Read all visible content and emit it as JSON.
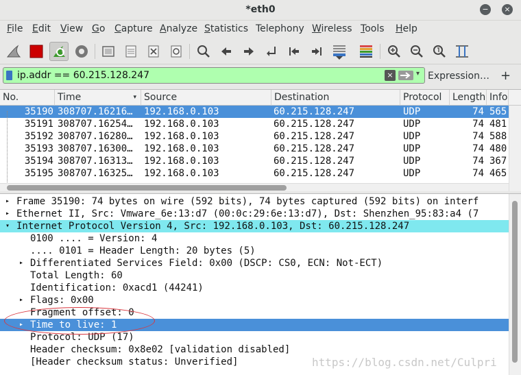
{
  "window": {
    "title": "*eth0",
    "minimize_glyph": "−",
    "close_glyph": "×"
  },
  "menubar": {
    "items": [
      {
        "acc": "F",
        "rest": "ile"
      },
      {
        "acc": "E",
        "rest": "dit"
      },
      {
        "acc": "V",
        "rest": "iew"
      },
      {
        "acc": "G",
        "rest": "o"
      },
      {
        "acc": "C",
        "rest": "apture"
      },
      {
        "acc": "A",
        "rest": "nalyze"
      },
      {
        "acc": "S",
        "rest": "tatistics"
      },
      {
        "acc": "",
        "rest": "Telephony"
      },
      {
        "acc": "W",
        "rest": "ireless"
      },
      {
        "acc": "T",
        "rest": "ools"
      },
      {
        "acc": "H",
        "rest": "elp"
      }
    ]
  },
  "toolbar": {
    "icons": [
      "shark-fin-icon",
      "stop-capture-icon",
      "restart-capture-icon",
      "capture-options-icon",
      "open-file-icon",
      "save-file-icon",
      "close-file-icon",
      "reload-file-icon",
      "find-packet-icon",
      "go-back-icon",
      "go-forward-icon",
      "go-to-packet-icon",
      "first-packet-icon",
      "last-packet-icon",
      "auto-scroll-icon",
      "colorize-icon",
      "zoom-in-icon",
      "zoom-out-icon",
      "normal-size-icon",
      "resize-columns-icon"
    ],
    "accent_red": "#cc0000",
    "accent_green": "#3c9a2c"
  },
  "filter": {
    "value": "ip.addr == 60.215.128.247",
    "expression_label": "Expression…",
    "add_label": "+",
    "bg_color": "#afffaf"
  },
  "packet_list": {
    "columns": [
      "No.",
      "Time",
      "Source",
      "Destination",
      "Protocol",
      "Length",
      "Info"
    ],
    "rows": [
      {
        "no": "35190",
        "time": "308707.16216…",
        "src": "192.168.0.103",
        "dst": "60.215.128.247",
        "proto": "UDP",
        "len": "74",
        "info": "565"
      },
      {
        "no": "35191",
        "time": "308707.16254…",
        "src": "192.168.0.103",
        "dst": "60.215.128.247",
        "proto": "UDP",
        "len": "74",
        "info": "481"
      },
      {
        "no": "35192",
        "time": "308707.16280…",
        "src": "192.168.0.103",
        "dst": "60.215.128.247",
        "proto": "UDP",
        "len": "74",
        "info": "588"
      },
      {
        "no": "35193",
        "time": "308707.16300…",
        "src": "192.168.0.103",
        "dst": "60.215.128.247",
        "proto": "UDP",
        "len": "74",
        "info": "480"
      },
      {
        "no": "35194",
        "time": "308707.16313…",
        "src": "192.168.0.103",
        "dst": "60.215.128.247",
        "proto": "UDP",
        "len": "74",
        "info": "367"
      },
      {
        "no": "35195",
        "time": "308707.16325…",
        "src": "192.168.0.103",
        "dst": "60.215.128.247",
        "proto": "UDP",
        "len": "74",
        "info": "465"
      }
    ],
    "selected_index": 0,
    "selected_color": "#4a90d9"
  },
  "packet_details": {
    "rows": [
      {
        "text": "Frame 35190: 74 bytes on wire (592 bits), 74 bytes captured (592 bits) on interf",
        "arrow": "▸",
        "indent": 0,
        "hl": ""
      },
      {
        "text": "Ethernet II, Src: Vmware_6e:13:d7 (00:0c:29:6e:13:d7), Dst: Shenzhen_95:83:a4 (7",
        "arrow": "▸",
        "indent": 0,
        "hl": ""
      },
      {
        "text": "Internet Protocol Version 4, Src: 192.168.0.103, Dst: 60.215.128.247",
        "arrow": "▾",
        "indent": 0,
        "hl": "cyan"
      },
      {
        "text": "0100 .... = Version: 4",
        "arrow": "",
        "indent": 1,
        "hl": ""
      },
      {
        "text": ".... 0101 = Header Length: 20 bytes (5)",
        "arrow": "",
        "indent": 1,
        "hl": ""
      },
      {
        "text": "Differentiated Services Field: 0x00 (DSCP: CS0, ECN: Not-ECT)",
        "arrow": "▸",
        "indent": 1,
        "hl": ""
      },
      {
        "text": "Total Length: 60",
        "arrow": "",
        "indent": 1,
        "hl": ""
      },
      {
        "text": "Identification: 0xacd1 (44241)",
        "arrow": "",
        "indent": 1,
        "hl": ""
      },
      {
        "text": "Flags: 0x00",
        "arrow": "▸",
        "indent": 1,
        "hl": ""
      },
      {
        "text": "Fragment offset: 0",
        "arrow": "",
        "indent": 1,
        "hl": ""
      },
      {
        "text": "Time to live: 1",
        "arrow": "▸",
        "indent": 1,
        "hl": "blue"
      },
      {
        "text": "Protocol: UDP (17)",
        "arrow": "",
        "indent": 1,
        "hl": ""
      },
      {
        "text": "Header checksum: 0x8e02 [validation disabled]",
        "arrow": "",
        "indent": 1,
        "hl": ""
      },
      {
        "text": "[Header checksum status: Unverified]",
        "arrow": "",
        "indent": 1,
        "hl": ""
      }
    ],
    "cyan_color": "#7fe8ef",
    "annotation_color": "#d9373f"
  },
  "watermark": "https://blog.csdn.net/Culpri"
}
